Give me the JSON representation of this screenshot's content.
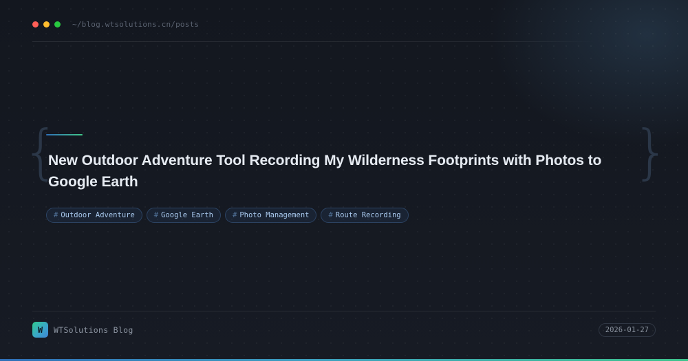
{
  "header": {
    "window_controls": [
      "close",
      "minimize",
      "maximize"
    ],
    "path": "~/blog.wtsolutions.cn/posts"
  },
  "post": {
    "title": "New Outdoor Adventure Tool Recording My Wilderness Footprints with Photos to Google Earth",
    "tags": [
      {
        "hash": "#",
        "label": "Outdoor Adventure"
      },
      {
        "hash": "#",
        "label": "Google Earth"
      },
      {
        "hash": "#",
        "label": "Photo Management"
      },
      {
        "hash": "#",
        "label": "Route Recording"
      }
    ],
    "brace_left": "{",
    "brace_right": "}"
  },
  "footer": {
    "logo_letter": "W",
    "brand_name": "WTSolutions Blog",
    "date": "2026-01-27"
  },
  "colors": {
    "background": "#13171f",
    "accent_blue": "#2f6fb7",
    "accent_green": "#41c98a",
    "tag_text": "#a9c9ee",
    "title_text": "#e6ebf2"
  }
}
